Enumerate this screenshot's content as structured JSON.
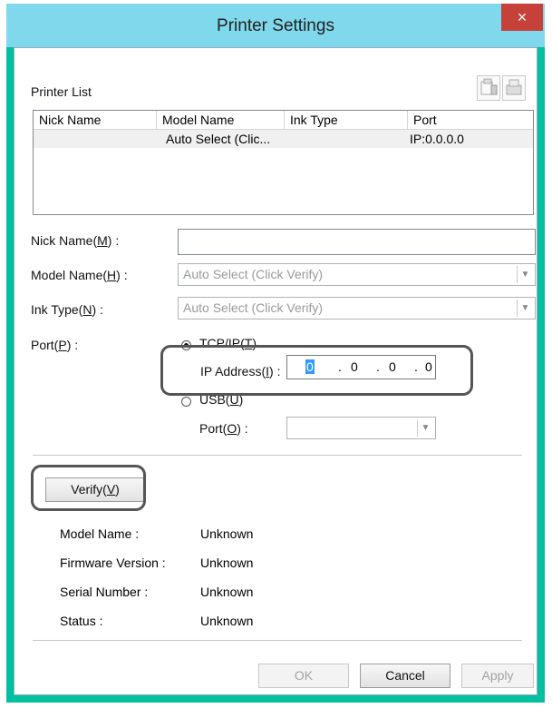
{
  "window": {
    "title": "Printer Settings",
    "close_glyph": "×"
  },
  "printer_list": {
    "label": "Printer List",
    "icons": [
      "printer-add-icon",
      "printer-delete-icon"
    ],
    "columns": [
      "Nick Name",
      "Model Name",
      "Ink Type",
      "Port"
    ],
    "rows": [
      {
        "nick": "",
        "model": "Auto Select (Clic...",
        "ink": "",
        "port": "IP:0.0.0.0"
      }
    ]
  },
  "fields": {
    "nick_name": {
      "label_pre": "Nick Name(",
      "key": "M",
      "label_post": ") :",
      "value": ""
    },
    "model_name": {
      "label_pre": "Model Name(",
      "key": "H",
      "label_post": ") :",
      "value": "Auto Select (Click Verify)"
    },
    "ink_type": {
      "label_pre": "Ink Type(",
      "key": "N",
      "label_post": ") :",
      "value": "Auto Select (Click Verify)"
    },
    "port": {
      "label_pre": "Port(",
      "key": "P",
      "label_post": ") :"
    }
  },
  "port": {
    "tcpip": {
      "label_pre": "TCP/IP(",
      "key": "T",
      "label_post": ")",
      "selected": true
    },
    "ip_address": {
      "label_pre": "IP Address(",
      "key": "I",
      "label_post": ") :",
      "octets": [
        "0",
        "0",
        "0",
        "0"
      ]
    },
    "usb": {
      "label_pre": "USB(",
      "key": "U",
      "label_post": ")",
      "selected": false
    },
    "usb_port": {
      "label_pre": "Port(",
      "key": "O",
      "label_post": ") :",
      "value": ""
    }
  },
  "verify": {
    "label_pre": "Verify(",
    "key": "V",
    "label_post": ")"
  },
  "info": [
    {
      "key": "Model Name :",
      "value": "Unknown"
    },
    {
      "key": "Firmware Version :",
      "value": "Unknown"
    },
    {
      "key": "Serial Number :",
      "value": "Unknown"
    },
    {
      "key": "Status :",
      "value": "Unknown"
    }
  ],
  "buttons": {
    "ok": "OK",
    "cancel": "Cancel",
    "apply": "Apply"
  },
  "colors": {
    "titlebar": "#80d8ec",
    "frame": "#00c0a0",
    "close": "#c7413b"
  }
}
